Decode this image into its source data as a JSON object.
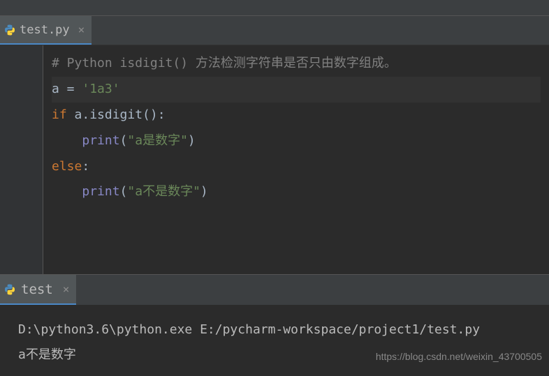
{
  "editor_tab": {
    "filename": "test.py",
    "close_glyph": "×"
  },
  "code": {
    "l1_comment": "# Python isdigit() 方法检测字符串是否只由数字组成。",
    "l2_var": "a",
    "l2_eq": " = ",
    "l2_str": "'1a3'",
    "l3_if": "if",
    "l3_cond": " a.isdigit():",
    "l4_print": "print",
    "l4_paren_open": "(",
    "l4_str": "\"a是数字\"",
    "l4_paren_close": ")",
    "l5_else": "else",
    "l5_colon": ":",
    "l6_print": "print",
    "l6_paren_open": "(",
    "l6_str": "\"a不是数字\"",
    "l6_paren_close": ")"
  },
  "console_tab": {
    "name": "test",
    "close_glyph": "×"
  },
  "console": {
    "line1": "D:\\python3.6\\python.exe E:/pycharm-workspace/project1/test.py",
    "line2": "a不是数字"
  },
  "watermark": "https://blog.csdn.net/weixin_43700505"
}
